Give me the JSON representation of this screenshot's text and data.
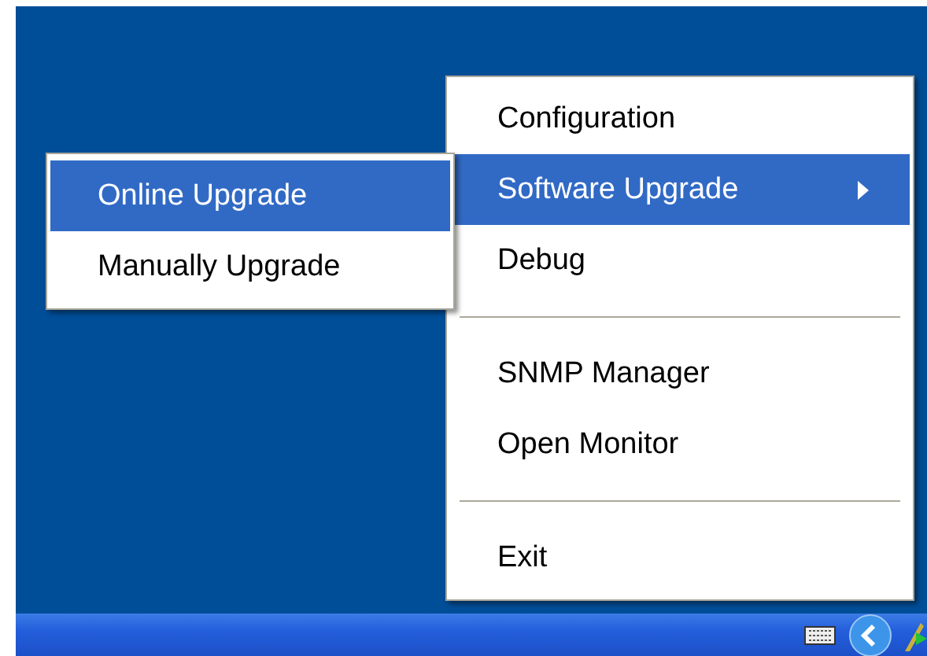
{
  "menu": {
    "items": [
      {
        "kind": "item",
        "label": "Configuration",
        "selected": false,
        "submenu": false
      },
      {
        "kind": "item",
        "label": "Software Upgrade",
        "selected": true,
        "submenu": true
      },
      {
        "kind": "item",
        "label": "Debug",
        "selected": false,
        "submenu": false
      },
      {
        "kind": "separator"
      },
      {
        "kind": "item",
        "label": "SNMP Manager",
        "selected": false,
        "submenu": false
      },
      {
        "kind": "item",
        "label": "Open Monitor",
        "selected": false,
        "submenu": false
      },
      {
        "kind": "separator"
      },
      {
        "kind": "item",
        "label": "Exit",
        "selected": false,
        "submenu": false
      }
    ]
  },
  "submenu": {
    "items": [
      {
        "label": "Online Upgrade",
        "selected": true
      },
      {
        "label": "Manually Upgrade",
        "selected": false
      }
    ]
  }
}
